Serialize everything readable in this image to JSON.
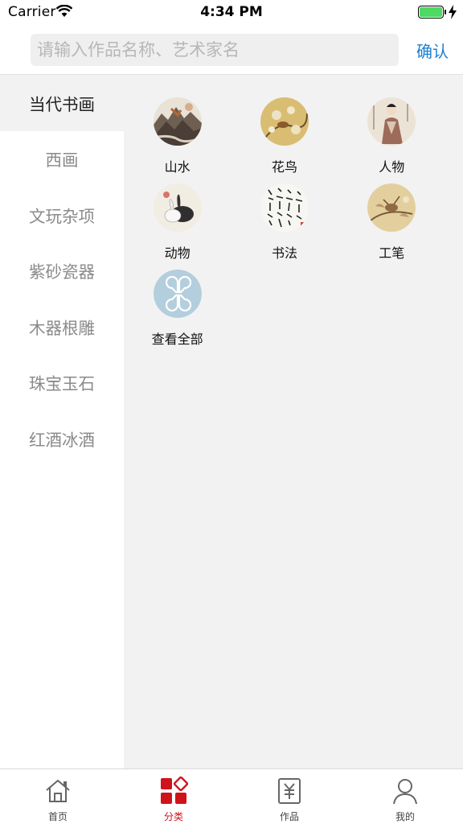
{
  "status_bar": {
    "carrier": "Carrier",
    "time": "4:34 PM"
  },
  "search": {
    "placeholder": "请输入作品名称、艺术家名",
    "value": "",
    "confirm_label": "确认"
  },
  "sidebar": {
    "items": [
      {
        "label": "当代书画",
        "active": true
      },
      {
        "label": "西画",
        "active": false
      },
      {
        "label": "文玩杂项",
        "active": false
      },
      {
        "label": "紫砂瓷器",
        "active": false
      },
      {
        "label": "木器根雕",
        "active": false
      },
      {
        "label": "珠宝玉石",
        "active": false
      },
      {
        "label": "红酒冰酒",
        "active": false
      }
    ]
  },
  "categories": {
    "items": [
      {
        "label": "山水",
        "icon": "landscape-painting-icon"
      },
      {
        "label": "花鸟",
        "icon": "flower-bird-painting-icon"
      },
      {
        "label": "人物",
        "icon": "figure-painting-icon"
      },
      {
        "label": "动物",
        "icon": "animal-painting-icon"
      },
      {
        "label": "书法",
        "icon": "calligraphy-icon"
      },
      {
        "label": "工笔",
        "icon": "gongbi-painting-icon"
      },
      {
        "label": "查看全部",
        "icon": "view-all-icon"
      }
    ]
  },
  "tabbar": {
    "items": [
      {
        "label": "首页",
        "icon": "home-icon",
        "active": false
      },
      {
        "label": "分类",
        "icon": "category-icon",
        "active": true
      },
      {
        "label": "作品",
        "icon": "artwork-yuan-icon",
        "active": false
      },
      {
        "label": "我的",
        "icon": "profile-icon",
        "active": false
      }
    ]
  },
  "colors": {
    "accent_red": "#d0121b",
    "link_blue": "#1a7fd4",
    "content_bg": "#f2f2f2",
    "battery_green": "#4cd964"
  }
}
